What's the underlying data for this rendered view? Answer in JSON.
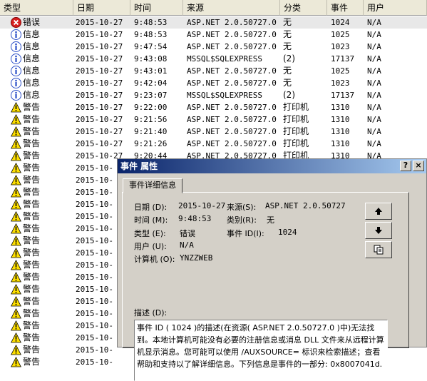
{
  "columns": [
    "类型",
    "日期",
    "时间",
    "来源",
    "分类",
    "事件",
    "用户"
  ],
  "rows": [
    {
      "icon": "error-icon",
      "type": "错误",
      "date": "2015-10-27",
      "time": "9:48:53",
      "source": "ASP.NET 2.0.50727.0",
      "category": "无",
      "event": "1024",
      "user": "N/A"
    },
    {
      "icon": "info-icon",
      "type": "信息",
      "date": "2015-10-27",
      "time": "9:48:53",
      "source": "ASP.NET 2.0.50727.0",
      "category": "无",
      "event": "1025",
      "user": "N/A"
    },
    {
      "icon": "info-icon",
      "type": "信息",
      "date": "2015-10-27",
      "time": "9:47:54",
      "source": "ASP.NET 2.0.50727.0",
      "category": "无",
      "event": "1023",
      "user": "N/A"
    },
    {
      "icon": "info-icon",
      "type": "信息",
      "date": "2015-10-27",
      "time": "9:43:08",
      "source": "MSSQL$SQLEXPRESS",
      "category": "(2)",
      "event": "17137",
      "user": "N/A"
    },
    {
      "icon": "info-icon",
      "type": "信息",
      "date": "2015-10-27",
      "time": "9:43:01",
      "source": "ASP.NET 2.0.50727.0",
      "category": "无",
      "event": "1025",
      "user": "N/A"
    },
    {
      "icon": "info-icon",
      "type": "信息",
      "date": "2015-10-27",
      "time": "9:42:04",
      "source": "ASP.NET 2.0.50727.0",
      "category": "无",
      "event": "1023",
      "user": "N/A"
    },
    {
      "icon": "info-icon",
      "type": "信息",
      "date": "2015-10-27",
      "time": "9:23:07",
      "source": "MSSQL$SQLEXPRESS",
      "category": "(2)",
      "event": "17137",
      "user": "N/A"
    },
    {
      "icon": "warning-icon",
      "type": "警告",
      "date": "2015-10-27",
      "time": "9:22:00",
      "source": "ASP.NET 2.0.50727.0",
      "category": "打印机",
      "event": "1310",
      "user": "N/A"
    },
    {
      "icon": "warning-icon",
      "type": "警告",
      "date": "2015-10-27",
      "time": "9:21:56",
      "source": "ASP.NET 2.0.50727.0",
      "category": "打印机",
      "event": "1310",
      "user": "N/A"
    },
    {
      "icon": "warning-icon",
      "type": "警告",
      "date": "2015-10-27",
      "time": "9:21:40",
      "source": "ASP.NET 2.0.50727.0",
      "category": "打印机",
      "event": "1310",
      "user": "N/A"
    },
    {
      "icon": "warning-icon",
      "type": "警告",
      "date": "2015-10-27",
      "time": "9:21:26",
      "source": "ASP.NET 2.0.50727.0",
      "category": "打印机",
      "event": "1310",
      "user": "N/A"
    },
    {
      "icon": "warning-icon",
      "type": "警告",
      "date": "2015-10-27",
      "time": "9:20:44",
      "source": "ASP.NET 2.0.50727.0",
      "category": "打印机",
      "event": "1310",
      "user": "N/A"
    },
    {
      "icon": "warning-icon",
      "type": "警告",
      "date": "2015-10-",
      "time": "",
      "source": "",
      "category": "",
      "event": "",
      "user": ""
    },
    {
      "icon": "warning-icon",
      "type": "警告",
      "date": "2015-10-",
      "time": "",
      "source": "",
      "category": "",
      "event": "",
      "user": ""
    },
    {
      "icon": "warning-icon",
      "type": "警告",
      "date": "2015-10-",
      "time": "",
      "source": "",
      "category": "",
      "event": "",
      "user": ""
    },
    {
      "icon": "warning-icon",
      "type": "警告",
      "date": "2015-10-",
      "time": "",
      "source": "",
      "category": "",
      "event": "",
      "user": ""
    },
    {
      "icon": "warning-icon",
      "type": "警告",
      "date": "2015-10-",
      "time": "",
      "source": "",
      "category": "",
      "event": "",
      "user": ""
    },
    {
      "icon": "warning-icon",
      "type": "警告",
      "date": "2015-10-",
      "time": "",
      "source": "",
      "category": "",
      "event": "",
      "user": ""
    },
    {
      "icon": "warning-icon",
      "type": "警告",
      "date": "2015-10-",
      "time": "",
      "source": "",
      "category": "",
      "event": "",
      "user": ""
    },
    {
      "icon": "warning-icon",
      "type": "警告",
      "date": "2015-10-",
      "time": "",
      "source": "",
      "category": "",
      "event": "",
      "user": ""
    },
    {
      "icon": "warning-icon",
      "type": "警告",
      "date": "2015-10-",
      "time": "",
      "source": "",
      "category": "",
      "event": "",
      "user": ""
    },
    {
      "icon": "warning-icon",
      "type": "警告",
      "date": "2015-10-",
      "time": "",
      "source": "",
      "category": "",
      "event": "",
      "user": ""
    },
    {
      "icon": "warning-icon",
      "type": "警告",
      "date": "2015-10-",
      "time": "",
      "source": "",
      "category": "",
      "event": "",
      "user": ""
    },
    {
      "icon": "warning-icon",
      "type": "警告",
      "date": "2015-10-",
      "time": "",
      "source": "",
      "category": "",
      "event": "",
      "user": ""
    },
    {
      "icon": "warning-icon",
      "type": "警告",
      "date": "2015-10-",
      "time": "",
      "source": "",
      "category": "",
      "event": "",
      "user": ""
    },
    {
      "icon": "warning-icon",
      "type": "警告",
      "date": "2015-10-",
      "time": "",
      "source": "",
      "category": "",
      "event": "",
      "user": ""
    },
    {
      "icon": "warning-icon",
      "type": "警告",
      "date": "2015-10-",
      "time": "",
      "source": "",
      "category": "",
      "event": "",
      "user": ""
    },
    {
      "icon": "warning-icon",
      "type": "警告",
      "date": "2015-10-",
      "time": "",
      "source": "",
      "category": "",
      "event": "",
      "user": ""
    },
    {
      "icon": "warning-icon",
      "type": "警告",
      "date": "2015-10-",
      "time": "",
      "source": "",
      "category": "",
      "event": "",
      "user": ""
    }
  ],
  "dialog": {
    "title": "事件 属性",
    "help_button": "?",
    "close_button": "×",
    "tab_label": "事件详细信息",
    "date_label": "日期 (D):",
    "date_value": "2015-10-27",
    "source_label": "来源(S):",
    "source_value": "ASP.NET 2.0.50727",
    "time_label": "时间 (M):",
    "time_value": "9:48:53",
    "category_label": "类别(R):",
    "category_value": "无",
    "type_label": "类型 (E):",
    "type_value": "错误",
    "eventid_label": "事件 ID(I):",
    "eventid_value": "1024",
    "user_label": "用户 (U):",
    "user_value": "N/A",
    "computer_label": "计算机 (O):",
    "computer_value": "YNZZWEB",
    "desc_label": "描述 (D):",
    "description": "事件 ID ( 1024 )的描述(在资源( ASP.NET 2.0.50727.0 )中)无法找到。本地计算机可能没有必要的注册信息或消息 DLL 文件来从远程计算机显示消息。您可能可以使用 /AUXSOURCE= 标识来检索描述；查看帮助和支持以了解详细信息。下列信息是事件的一部分: 0x8007041d."
  },
  "colors": {
    "title_bar_start": "#0a246a",
    "title_bar_end": "#a6caf0",
    "dialog_face": "#d4d0c8",
    "warning_yellow": "#ffe000",
    "error_red": "#d62020",
    "info_blue": "#2c4fc8"
  }
}
